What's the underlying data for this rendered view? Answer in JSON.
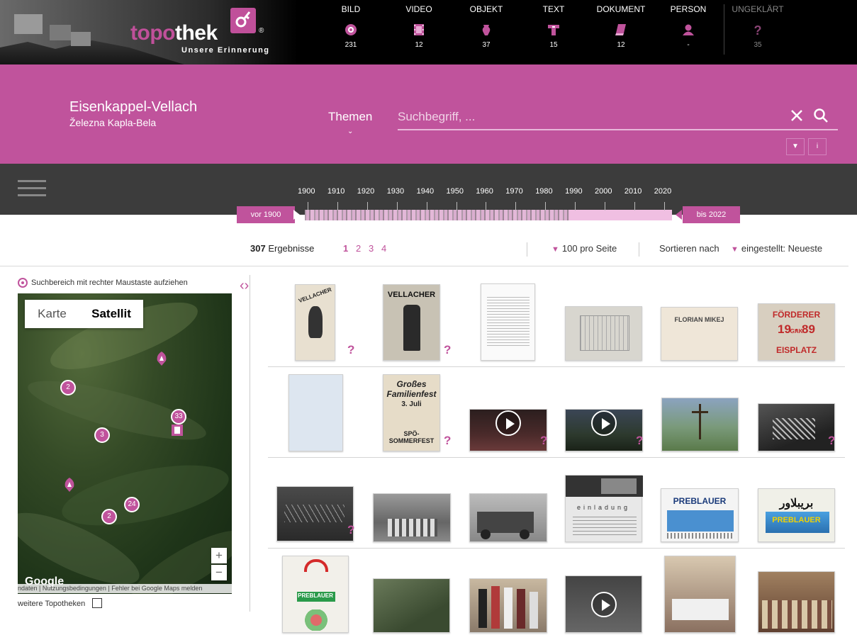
{
  "header": {
    "logo_part1": "topo",
    "logo_part2": "thek",
    "registered": "®",
    "tagline": "Unsere Erinnerung",
    "categories": [
      {
        "label": "BILD",
        "count": "231",
        "icon": "image-icon"
      },
      {
        "label": "VIDEO",
        "count": "12",
        "icon": "film-icon"
      },
      {
        "label": "OBJEKT",
        "count": "37",
        "icon": "vase-icon"
      },
      {
        "label": "TEXT",
        "count": "15",
        "icon": "text-icon"
      },
      {
        "label": "DOKUMENT",
        "count": "12",
        "icon": "document-icon"
      },
      {
        "label": "PERSON",
        "count": "-",
        "icon": "person-icon"
      },
      {
        "label": "UNGEKLÄRT",
        "count": "35",
        "icon": "question-icon"
      }
    ]
  },
  "place": {
    "title": "Eisenkappel-Vellach",
    "subtitle": "Železna Kapla-Bela"
  },
  "search": {
    "themen_label": "Themen",
    "placeholder": "Suchbegriff, ...",
    "filter_btn": "▼",
    "info_btn": "i"
  },
  "timeline": {
    "years": [
      "1900",
      "1910",
      "1920",
      "1930",
      "1940",
      "1950",
      "1960",
      "1970",
      "1980",
      "1990",
      "2000",
      "2010",
      "2020"
    ],
    "from_label": "vor 1900",
    "to_label": "bis 2022"
  },
  "results": {
    "count": "307",
    "count_label": "Ergebnisse",
    "pages": [
      "1",
      "2",
      "3",
      "4"
    ],
    "per_page": "100 pro Seite",
    "sort_label": "Sortieren nach",
    "sort_value": "eingestellt: Neueste"
  },
  "map": {
    "instruction": "Suchbereich mit rechter Maustaste aufziehen",
    "type_karte": "Karte",
    "type_satellit": "Satellit",
    "clusters": [
      "2",
      "33",
      "3",
      "24",
      "2"
    ],
    "zoom_in": "+",
    "zoom_out": "−",
    "google": "Google",
    "footer": "ndaten  |  Nutzungsbedingungen  |  Fehler bei Google Maps melden",
    "weitere": "weitere Topotheken"
  },
  "thumbnails": {
    "poster1": "VELLACHER",
    "poster2": "VELLACHER",
    "envelope": "FLORIAN MIKEJ",
    "sticker_top": "FÖRDERER",
    "sticker_mid": "19 - 89",
    "sticker_gak": "GAK",
    "sticker_bottom": "EISPLATZ",
    "fest_title": "Großes Familienfest",
    "fest_date": "3. Juli",
    "fest_bottom": "SPÖ-SOMMERFEST",
    "einladung": "einladung",
    "preblauer": "PREBLAUER",
    "arabic_title": "بريبلاور",
    "preblauer2": "PREBLAUER",
    "bag_label": "PREBLAUER"
  },
  "colors": {
    "brand": "#c0539c",
    "top": "#000000",
    "timeline_bg": "#3c3c3c"
  }
}
